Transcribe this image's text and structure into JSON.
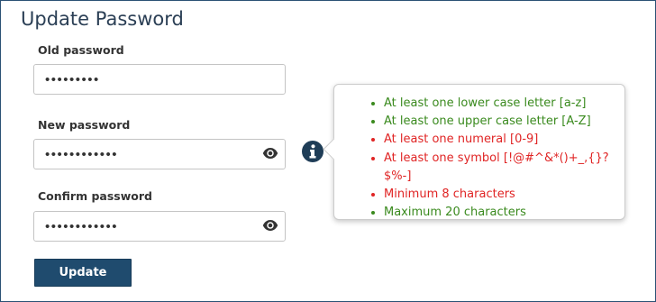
{
  "page": {
    "title": "Update Password"
  },
  "form": {
    "old_password": {
      "label": "Old password",
      "value": "•••••••••"
    },
    "new_password": {
      "label": "New password",
      "value": "••••••••••••"
    },
    "confirm_password": {
      "label": "Confirm password",
      "value": "••••••••••••"
    },
    "submit_label": "Update"
  },
  "requirements": [
    {
      "text": "At least one lower case letter [a-z]",
      "status": "met",
      "color": "#3a8a1e"
    },
    {
      "text": "At least one upper case letter [A-Z]",
      "status": "met",
      "color": "#3a8a1e"
    },
    {
      "text": "At least one numeral [0-9]",
      "status": "unmet",
      "color": "#e02424"
    },
    {
      "text": "At least one symbol [!@#^&*()+_,{}?$%-]",
      "status": "unmet",
      "color": "#e02424"
    },
    {
      "text": "Minimum 8 characters",
      "status": "unmet",
      "color": "#e02424"
    },
    {
      "text": "Maximum 20 characters",
      "status": "met",
      "color": "#3a8a1e"
    }
  ],
  "icons": {
    "info": "info-icon",
    "show_password": "eye-icon"
  },
  "colors": {
    "primary": "#1f4b6e",
    "title": "#2b3f55",
    "met": "#3a8a1e",
    "unmet": "#e02424"
  }
}
